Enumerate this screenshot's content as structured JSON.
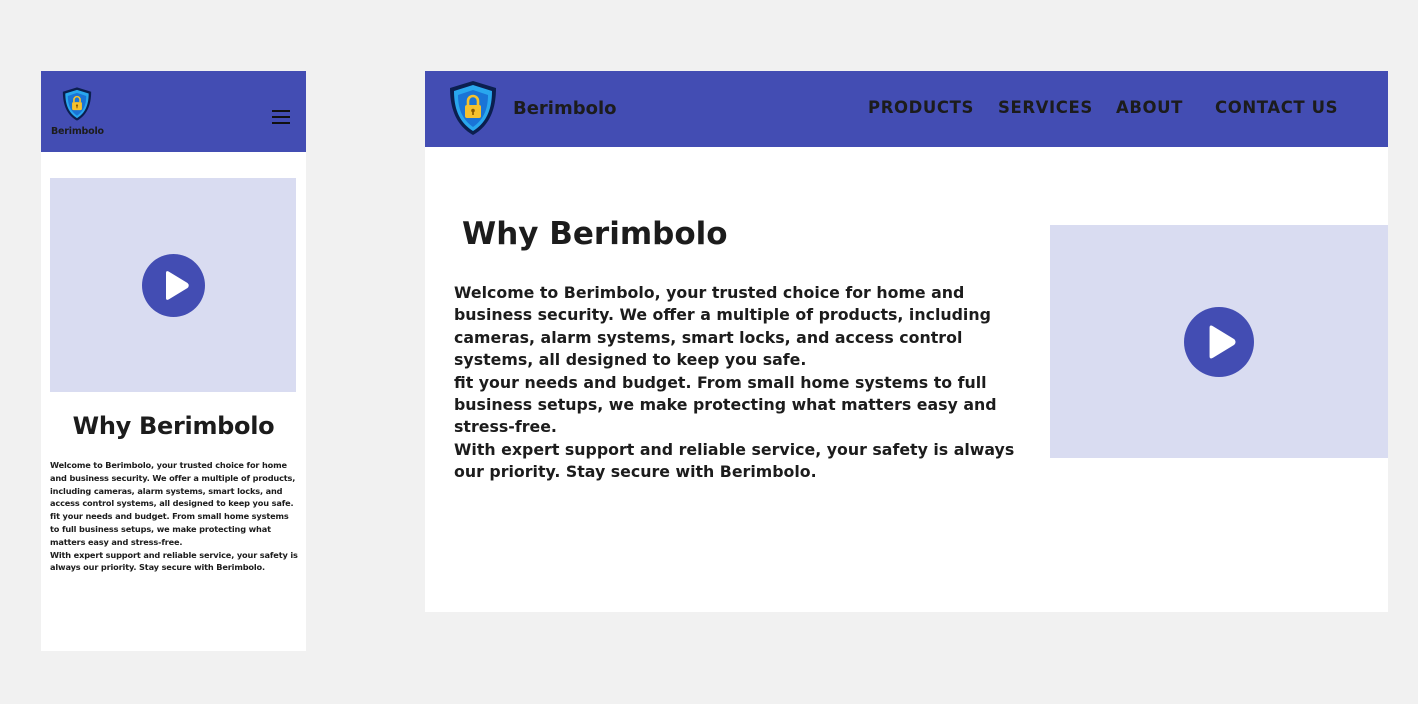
{
  "brand": {
    "name": "Berimbolo",
    "primary_color": "#434db3",
    "video_placeholder_color": "#d9dcf1",
    "logo_icon": "shield-lock-icon"
  },
  "nav": {
    "items": [
      {
        "label": "PRODUCTS"
      },
      {
        "label": "SERVICES"
      },
      {
        "label": "ABOUT"
      },
      {
        "label": "CONTACT US"
      }
    ],
    "menu_icon": "hamburger-menu-icon"
  },
  "section": {
    "title": "Why Berimbolo",
    "paragraphs": [
      "Welcome to Berimbolo, your trusted choice for home and business security. We offer a multiple of products, including cameras, alarm systems, smart locks, and access control systems, all designed to keep you safe.",
      "fit your needs and budget. From small home systems to full business setups, we make protecting what matters easy and stress-free.",
      "With expert support and reliable service, your safety is always our priority. Stay secure with Berimbolo."
    ],
    "video_icon": "play-icon"
  }
}
